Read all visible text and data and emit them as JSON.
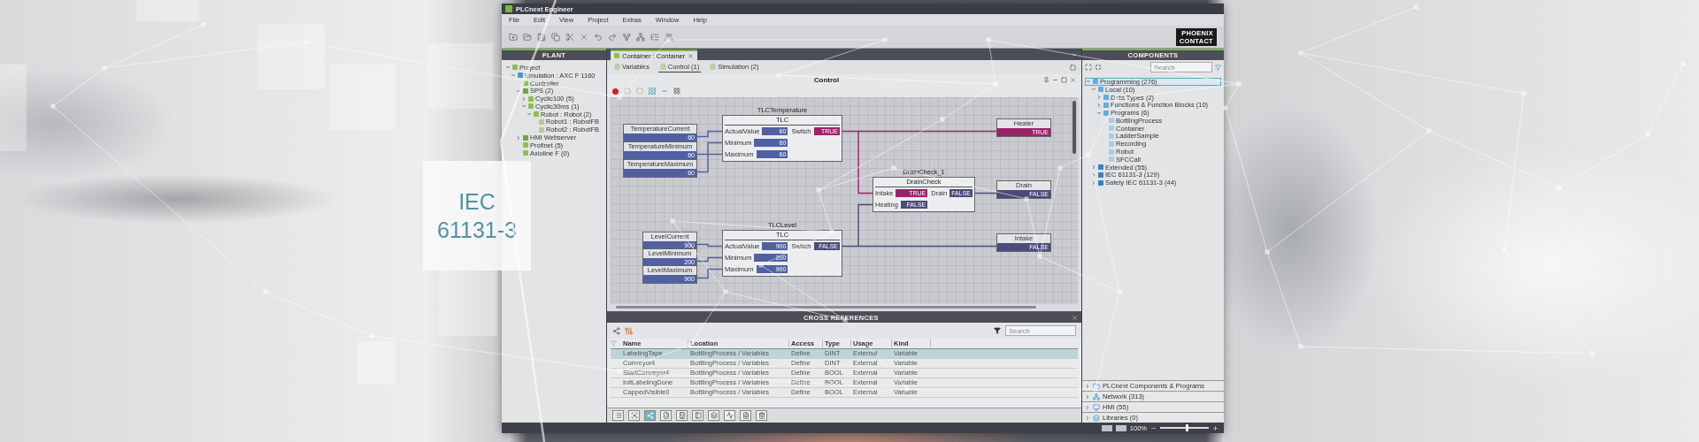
{
  "badge": {
    "lines": [
      "IEC",
      "61131-3"
    ]
  },
  "window": {
    "title": "PLCnext Engineer",
    "logo": [
      "PHOENIX",
      "CONTACT"
    ]
  },
  "menu": [
    "File",
    "Edit",
    "View",
    "Project",
    "Extras",
    "Window",
    "Help"
  ],
  "plant": {
    "title": "PLANT",
    "tree": [
      {
        "label": "Project",
        "kind": "folder",
        "expanded": true,
        "children": [
          {
            "label": "Emulation : AXC F 1160",
            "kind": "device",
            "expanded": true,
            "children": [
              {
                "label": "Controller",
                "kind": "controller"
              },
              {
                "label": "SPS (2)",
                "kind": "resource",
                "expanded": true,
                "children": [
                  {
                    "label": "Cyclic100 (5)",
                    "kind": "task",
                    "expanded": false
                  },
                  {
                    "label": "Cyclic30ms (1)",
                    "kind": "task",
                    "expanded": true,
                    "children": [
                      {
                        "label": "Robot : Robot (2)",
                        "kind": "program",
                        "expanded": true,
                        "children": [
                          {
                            "label": "Robot1 : RobotFB",
                            "kind": "instance"
                          },
                          {
                            "label": "Robot2 : RobotFB",
                            "kind": "instance"
                          }
                        ]
                      }
                    ]
                  }
                ]
              },
              {
                "label": "HMI Webserver",
                "kind": "hmi",
                "expanded": false
              },
              {
                "label": "Profinet (5)",
                "kind": "bus"
              },
              {
                "label": "Axioline F (0)",
                "kind": "bus"
              }
            ]
          }
        ]
      }
    ]
  },
  "editor": {
    "tab": "Container : Container",
    "subtabs": [
      {
        "label": "Variables",
        "selected": false
      },
      {
        "label": "Control (1)",
        "selected": true
      },
      {
        "label": "Simulation (2)",
        "selected": false
      }
    ],
    "title": "Control",
    "diagram": {
      "inputs": [
        {
          "name": "TemperatureCurrent",
          "value": "60",
          "kind": "int"
        },
        {
          "name": "TemperatureMinimum",
          "value": "60",
          "kind": "int"
        },
        {
          "name": "TemperatureMaximum",
          "value": "60",
          "kind": "int"
        },
        {
          "name": "LevelCurrent",
          "value": "900",
          "kind": "int"
        },
        {
          "name": "LevelMinimum",
          "value": "200",
          "kind": "int"
        },
        {
          "name": "LevelMaximum",
          "value": "900",
          "kind": "int"
        }
      ],
      "blocks": [
        {
          "instance": "TLCTemperature",
          "type": "TLC",
          "inputs": [
            {
              "label": "ActualValue",
              "value": "60",
              "kind": "int"
            },
            {
              "label": "Minimum",
              "value": "60",
              "kind": "int"
            },
            {
              "label": "Maximum",
              "value": "60",
              "kind": "int"
            }
          ],
          "outputs": [
            {
              "label": "Switch",
              "value": "TRUE",
              "kind": "on"
            }
          ]
        },
        {
          "instance": "DrainCheck_1",
          "type": "DrainCheck",
          "inputs": [
            {
              "label": "Intake",
              "value": "TRUE",
              "kind": "on"
            },
            {
              "label": "Heating",
              "value": "FALSE",
              "kind": "off"
            }
          ],
          "outputs": [
            {
              "label": "Drain",
              "value": "FALSE",
              "kind": "off"
            }
          ]
        },
        {
          "instance": "TLCLevel",
          "type": "TLC",
          "inputs": [
            {
              "label": "ActualValue",
              "value": "900",
              "kind": "int"
            },
            {
              "label": "Minimum",
              "value": "200",
              "kind": "int"
            },
            {
              "label": "Maximum",
              "value": "900",
              "kind": "int"
            }
          ],
          "outputs": [
            {
              "label": "Switch",
              "value": "FALSE",
              "kind": "off"
            }
          ]
        }
      ],
      "outputs": [
        {
          "name": "Heater",
          "value": "TRUE",
          "kind": "on"
        },
        {
          "name": "Drain",
          "value": "FALSE",
          "kind": "off"
        },
        {
          "name": "Intake",
          "value": "FALSE",
          "kind": "off"
        }
      ]
    }
  },
  "cross_references": {
    "title": "CROSS REFERENCES",
    "search": {
      "placeholder": "Search"
    },
    "columns": [
      "Name",
      "Location",
      "Access",
      "Type",
      "Usage",
      "Kind"
    ],
    "rows": [
      {
        "cells": [
          "LabelingTape",
          "BottlingProcess / Variables",
          "Define",
          "DINT",
          "External",
          "Variable"
        ],
        "selected": true
      },
      {
        "cells": [
          "Conveyor4",
          "BottlingProcess / Variables",
          "Define",
          "DINT",
          "External",
          "Variable"
        ],
        "selected": false
      },
      {
        "cells": [
          "StartConveyor4",
          "BottlingProcess / Variables",
          "Define",
          "BOOL",
          "External",
          "Variable"
        ],
        "selected": false
      },
      {
        "cells": [
          "InitLabelingDone",
          "BottlingProcess / Variables",
          "Define",
          "BOOL",
          "External",
          "Variable"
        ],
        "selected": false
      },
      {
        "cells": [
          "CappedVisible0",
          "BottlingProcess / Variables",
          "Define",
          "BOOL",
          "External",
          "Variable"
        ],
        "selected": false
      }
    ],
    "view_buttons": [
      {
        "selected": false
      },
      {
        "selected": false
      },
      {
        "selected": true
      },
      {
        "selected": false
      },
      {
        "selected": false
      },
      {
        "selected": false
      },
      {
        "selected": false
      },
      {
        "selected": false
      },
      {
        "selected": false
      },
      {
        "selected": false
      }
    ]
  },
  "components": {
    "title": "COMPONENTS",
    "search": {
      "placeholder": "Search"
    },
    "tree": [
      {
        "label": "Programming (276)",
        "kind": "folder",
        "expanded": true,
        "selected": true,
        "children": [
          {
            "label": "Local (10)",
            "kind": "folder",
            "expanded": true,
            "selected": false,
            "children": [
              {
                "label": "Data Types (2)",
                "kind": "folder",
                "expanded": false,
                "selected": false
              },
              {
                "label": "Functions & Function Blocks (10)",
                "kind": "folder",
                "expanded": false,
                "selected": false
              },
              {
                "label": "Programs (6)",
                "kind": "folder",
                "expanded": true,
                "selected": false,
                "children": [
                  {
                    "label": "BottlingProcess",
                    "kind": "program",
                    "selected": false
                  },
                  {
                    "label": "Container",
                    "kind": "program",
                    "selected": false
                  },
                  {
                    "label": "LadderSample",
                    "kind": "program",
                    "selected": false
                  },
                  {
                    "label": "Recording",
                    "kind": "program",
                    "selected": false
                  },
                  {
                    "label": "Robot",
                    "kind": "program",
                    "selected": false
                  },
                  {
                    "label": "SFCCall",
                    "kind": "program",
                    "selected": false
                  }
                ]
              }
            ]
          },
          {
            "label": "Extended (55)",
            "kind": "library",
            "expanded": false,
            "selected": false
          },
          {
            "label": "IEC 61131-3 (129)",
            "kind": "library",
            "expanded": false,
            "selected": false
          },
          {
            "label": "Safety IEC 61131-3 (44)",
            "kind": "library",
            "expanded": false,
            "selected": false
          }
        ]
      }
    ],
    "sections": [
      {
        "label": "PLCnext Components & Programs",
        "kind": "folder"
      },
      {
        "label": "Network (313)",
        "kind": "network"
      },
      {
        "label": "HMI (55)",
        "kind": "hmi"
      },
      {
        "label": "Libraries (0)",
        "kind": "library"
      }
    ]
  },
  "status_bar": {
    "zoom": {
      "reading": "100%",
      "level": 0.55
    }
  }
}
